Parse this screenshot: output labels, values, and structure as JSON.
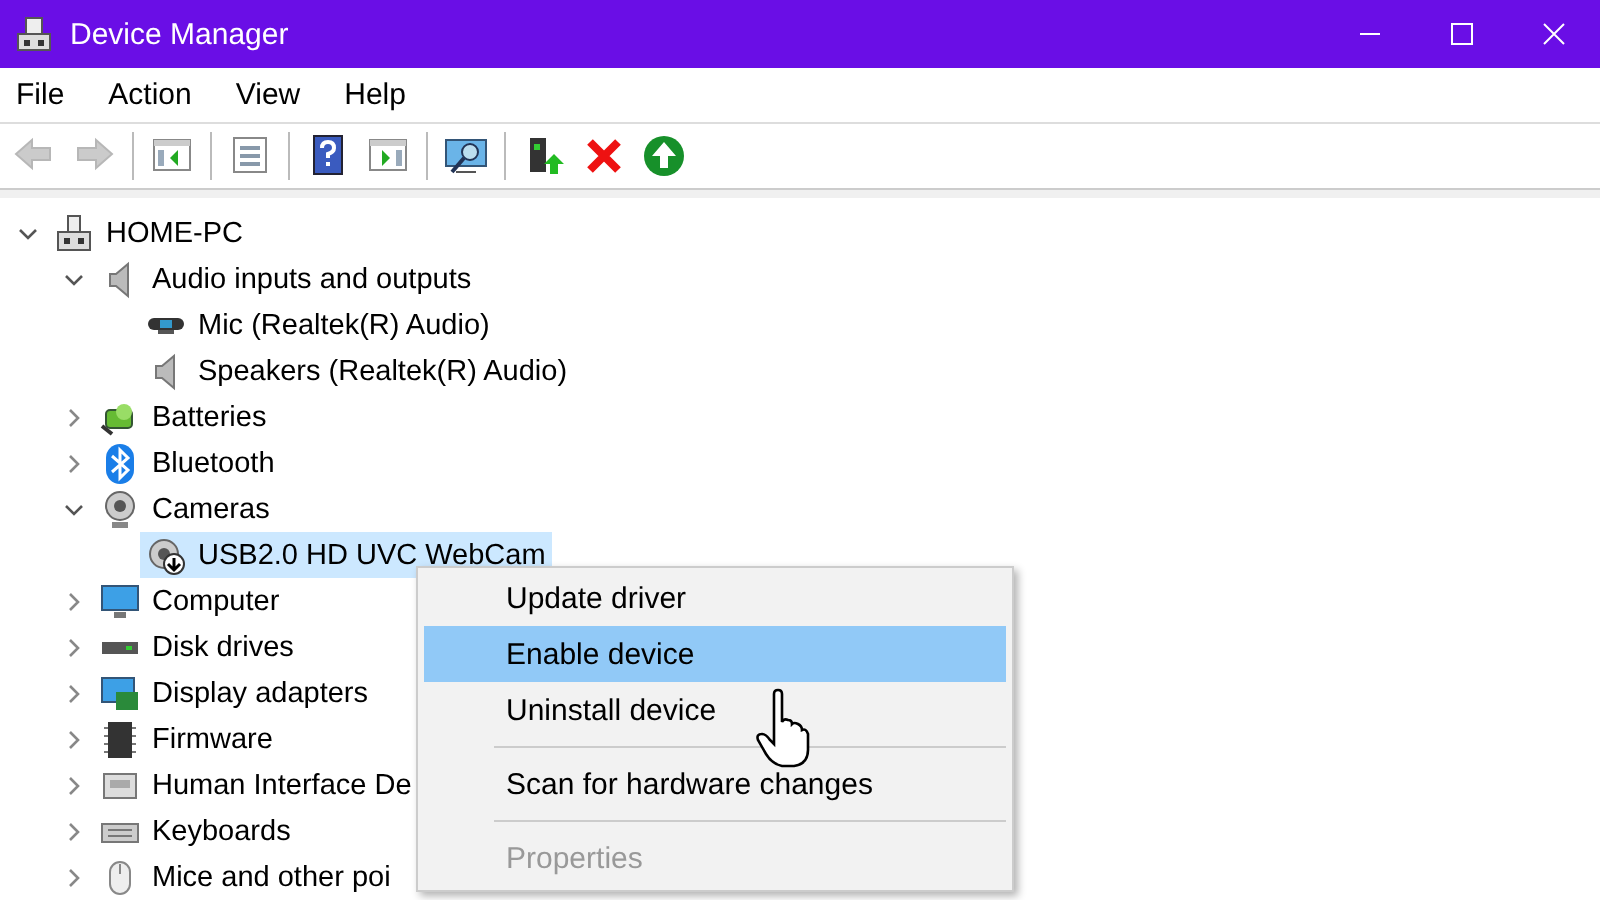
{
  "window": {
    "title": "Device Manager"
  },
  "menu_bar": [
    "File",
    "Action",
    "View",
    "Help"
  ],
  "toolbar": [
    {
      "kind": "back",
      "disabled": true
    },
    {
      "kind": "forward",
      "disabled": true
    },
    {
      "kind": "separator"
    },
    {
      "kind": "console-tree",
      "disabled": false
    },
    {
      "kind": "separator"
    },
    {
      "kind": "properties",
      "disabled": false
    },
    {
      "kind": "separator"
    },
    {
      "kind": "help",
      "disabled": false
    },
    {
      "kind": "action-pane",
      "disabled": false
    },
    {
      "kind": "separator"
    },
    {
      "kind": "scan",
      "disabled": false
    },
    {
      "kind": "separator"
    },
    {
      "kind": "update-driver",
      "disabled": false
    },
    {
      "kind": "uninstall",
      "disabled": false
    },
    {
      "kind": "enable",
      "disabled": false
    }
  ],
  "tree": [
    {
      "label": "HOME-PC",
      "kind": "computer-tower",
      "expanded": true,
      "selected": false,
      "children": [
        {
          "label": "Audio inputs and outputs",
          "kind": "speaker",
          "expanded": true,
          "selected": false,
          "children": [
            {
              "label": "Mic (Realtek(R) Audio)",
              "kind": "microphone",
              "selected": false
            },
            {
              "label": "Speakers (Realtek(R) Audio)",
              "kind": "speaker",
              "selected": false
            }
          ]
        },
        {
          "label": "Batteries",
          "kind": "battery",
          "expanded": false,
          "selected": false
        },
        {
          "label": "Bluetooth",
          "kind": "bluetooth",
          "expanded": false,
          "selected": false
        },
        {
          "label": "Cameras",
          "kind": "camera",
          "expanded": true,
          "selected": false,
          "children": [
            {
              "label": "USB2.0 HD UVC WebCam",
              "kind": "camera-disabled",
              "selected": true
            }
          ]
        },
        {
          "label": "Computer",
          "kind": "monitor",
          "expanded": false,
          "selected": false
        },
        {
          "label": "Disk drives",
          "kind": "drive",
          "expanded": false,
          "selected": false
        },
        {
          "label": "Display adapters",
          "kind": "display-adapter",
          "expanded": false,
          "selected": false
        },
        {
          "label": "Firmware",
          "kind": "chip",
          "expanded": false,
          "selected": false
        },
        {
          "label": "Human Interface De",
          "kind": "hid",
          "expanded": false,
          "selected": false
        },
        {
          "label": "Keyboards",
          "kind": "keyboard",
          "expanded": false,
          "selected": false
        },
        {
          "label": "Mice and other poi",
          "kind": "mouse",
          "expanded": false,
          "selected": false
        }
      ]
    }
  ],
  "context_menu": [
    {
      "kind": "item",
      "label": "Update driver",
      "selected": false,
      "disabled": false
    },
    {
      "kind": "item",
      "label": "Enable device",
      "selected": true,
      "disabled": false
    },
    {
      "kind": "item",
      "label": "Uninstall device",
      "selected": false,
      "disabled": false
    },
    {
      "kind": "separator"
    },
    {
      "kind": "item",
      "label": "Scan for hardware changes",
      "selected": false,
      "disabled": false
    },
    {
      "kind": "separator"
    },
    {
      "kind": "item",
      "label": "Properties",
      "selected": false,
      "disabled": true
    }
  ]
}
